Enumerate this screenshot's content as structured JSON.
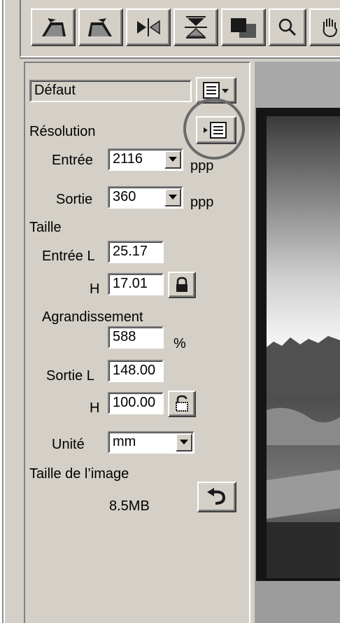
{
  "toolbar": {
    "buttons": [
      {
        "name": "rotate-left",
        "icon": "rotate-left-icon"
      },
      {
        "name": "rotate-right",
        "icon": "rotate-right-icon"
      },
      {
        "name": "flip-horizontal",
        "icon": "flip-horizontal-icon"
      },
      {
        "name": "flip-vertical",
        "icon": "flip-vertical-icon"
      },
      {
        "name": "invert-colors",
        "icon": "invert-colors-icon"
      },
      {
        "name": "zoom",
        "icon": "magnifier-icon"
      },
      {
        "name": "pan",
        "icon": "hand-icon"
      }
    ]
  },
  "settings": {
    "preset": "Défaut",
    "resolution_label": "Résolution",
    "input_label": "Entrée",
    "input_resolution": "2116",
    "input_unit": "ppp",
    "output_label": "Sortie",
    "output_resolution": "360",
    "output_unit": "ppp",
    "size_label": "Taille",
    "input_width_label": "Entrée L",
    "input_width": "25.17",
    "input_height_label": "H",
    "input_height": "17.01",
    "enlargement_label": "Agrandissement",
    "enlargement": "588",
    "enlargement_unit": "%",
    "output_width_label": "Sortie L",
    "output_width": "148.00",
    "output_height_label": "H",
    "output_height": "100.00",
    "unit_label": "Unité",
    "unit": "mm",
    "image_size_label": "Taille de l’image",
    "image_size": "8.5MB"
  },
  "colors": {
    "panel_bg": "#d4d0c8",
    "preview_border": "#151515",
    "highlight_circle": "#6b6b6b"
  }
}
